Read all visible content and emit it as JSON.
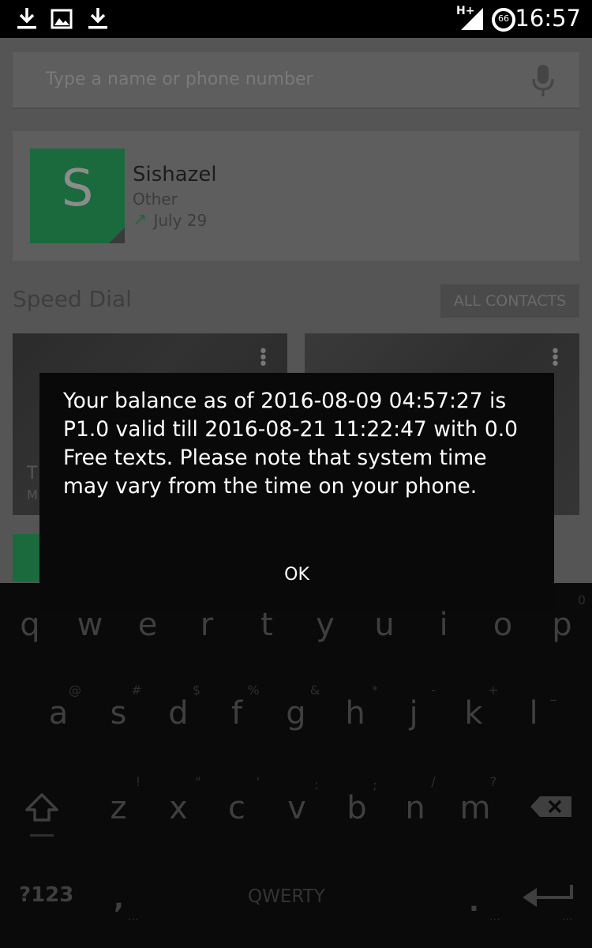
{
  "status_bar": {
    "icons": [
      "download-icon",
      "image-icon",
      "download-icon"
    ],
    "network": "H+",
    "battery": "66",
    "time": "16:57"
  },
  "search": {
    "placeholder": "Type a name or phone number"
  },
  "contact_card": {
    "avatar_letter": "S",
    "name": "Sishazel",
    "type": "Other",
    "date": "July 29"
  },
  "speed_dial": {
    "title": "Speed Dial",
    "all_contacts_label": "ALL CONTACTS",
    "tiles": [
      {
        "label": "T",
        "sub": "M"
      },
      {
        "label": "",
        "sub": ""
      }
    ]
  },
  "dialog": {
    "message": "Your balance as of 2016-08-09 04:57:27 is P1.0 valid till 2016-08-21 11:22:47 with 0.0 Free texts. Please note that system time may vary from the time on your phone.",
    "ok_label": "OK"
  },
  "keyboard": {
    "row1": [
      "q",
      "w",
      "e",
      "r",
      "t",
      "y",
      "u",
      "i",
      "o",
      "p"
    ],
    "row1_hint": "0",
    "row2": [
      "a",
      "s",
      "d",
      "f",
      "g",
      "h",
      "j",
      "k",
      "l"
    ],
    "row2_hints": [
      "@",
      "#",
      "$",
      "%",
      "&",
      "*",
      "-",
      "+",
      "_"
    ],
    "row3": [
      "z",
      "x",
      "c",
      "v",
      "b",
      "n",
      "m"
    ],
    "row3_hints": [
      "!",
      "\"",
      "'",
      ":",
      ";",
      "/",
      "?"
    ],
    "symbols_label": "?123",
    "comma": ",",
    "space_label": "QWERTY",
    "period": "."
  }
}
